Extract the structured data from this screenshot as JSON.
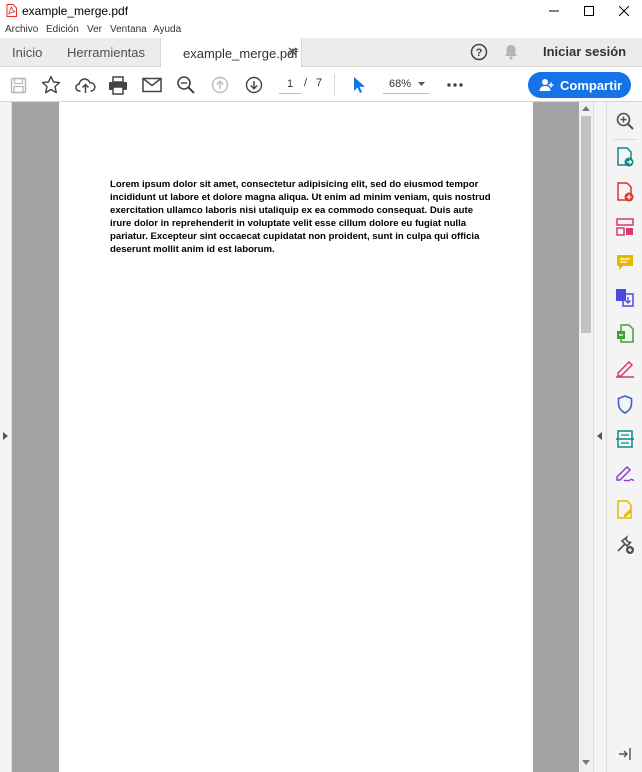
{
  "window": {
    "title": "example_merge.pdf"
  },
  "menu": {
    "items": [
      "Archivo",
      "Edición",
      "Ver",
      "Ventana",
      "Ayuda"
    ]
  },
  "tabs": {
    "home": "Inicio",
    "tools": "Herramientas",
    "document": "example_merge.pdf"
  },
  "header": {
    "signin_label": "Iniciar sesión"
  },
  "toolbar": {
    "current_page": "1",
    "page_separator": "/",
    "total_pages": "7",
    "zoom": "68%",
    "share_label": "Compartir"
  },
  "document": {
    "body": "Lorem ipsum dolor sit amet, consectetur adipisicing elit, sed do eiusmod tempor incididunt ut labore et dolore magna aliqua. Ut enim ad minim veniam, quis nostrud exercitation ullamco laboris nisi utaliquip ex ea commodo consequat. Duis aute irure dolor in reprehenderit in voluptate velit esse cillum dolore eu fugiat nulla pariatur. Excepteur sint occaecat cupidatat non proident, sunt in culpa qui officia deserunt mollit anim id est laborum."
  },
  "right_tools": [
    {
      "icon": "zoom-search-icon",
      "color": "#505050"
    },
    {
      "icon": "export-pdf-icon",
      "color": "#0e8a8a"
    },
    {
      "icon": "create-pdf-icon",
      "color": "#e0302a"
    },
    {
      "icon": "organize-pages-icon",
      "color": "#d63b6e"
    },
    {
      "icon": "comment-icon",
      "color": "#e8b800"
    },
    {
      "icon": "combine-files-icon",
      "color": "#4a4adb"
    },
    {
      "icon": "compress-pdf-icon",
      "color": "#3aa63a"
    },
    {
      "icon": "fill-sign-icon",
      "color": "#d6357a"
    },
    {
      "icon": "protect-icon",
      "color": "#3d62c6"
    },
    {
      "icon": "scan-ocr-icon",
      "color": "#0e8a8a"
    },
    {
      "icon": "request-signature-icon",
      "color": "#8a3ccf"
    },
    {
      "icon": "edit-pdf-icon",
      "color": "#e8b800"
    },
    {
      "icon": "more-tools-icon",
      "color": "#505050"
    }
  ],
  "colors": {
    "accent": "#1473e6",
    "canvas": "#a3a3a3"
  }
}
